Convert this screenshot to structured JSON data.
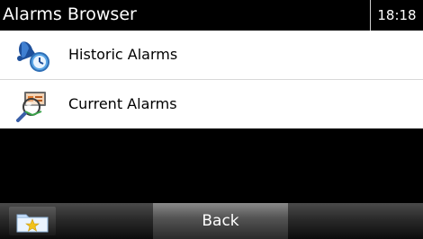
{
  "header": {
    "title": "Alarms Browser",
    "time": "18:18"
  },
  "menu": {
    "items": [
      {
        "label": "Historic Alarms",
        "icon": "bell-clock-icon"
      },
      {
        "label": "Current Alarms",
        "icon": "alarm-search-icon"
      }
    ]
  },
  "toolbar": {
    "favorites_icon": "folder-star-icon",
    "back_label": "Back"
  },
  "colors": {
    "background": "#000000",
    "list_background": "#ffffff",
    "divider": "#d8d8d8",
    "text_light": "#ffffff",
    "text_dark": "#000000"
  }
}
